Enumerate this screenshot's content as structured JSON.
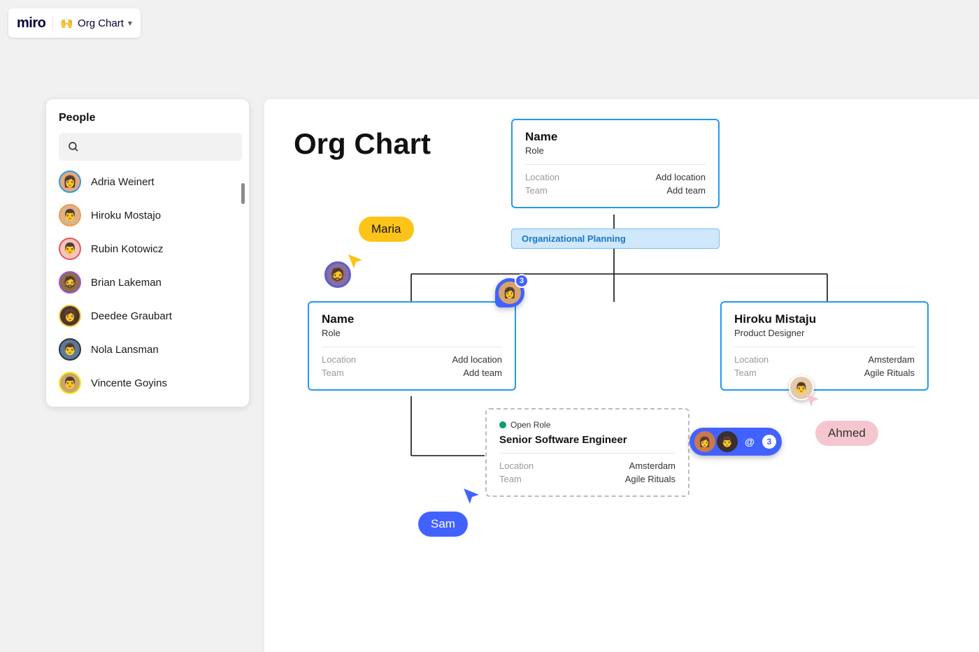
{
  "header": {
    "logo_text": "miro",
    "board_emoji": "🙌",
    "board_name": "Org Chart"
  },
  "sidebar": {
    "title": "People",
    "search_placeholder": "",
    "people": [
      {
        "name": "Adria Weinert",
        "avatar_bg": "#e8a87c",
        "avatar_border": "#2d9cdb"
      },
      {
        "name": "Hiroku Mostajo",
        "avatar_bg": "#d9b48f",
        "avatar_border": "#f2994a"
      },
      {
        "name": "Rubin Kotowicz",
        "avatar_bg": "#f2c4c4",
        "avatar_border": "#eb5757"
      },
      {
        "name": "Brian Lakeman",
        "avatar_bg": "#8b6f47",
        "avatar_border": "#9b51e0"
      },
      {
        "name": "Deedee Graubart",
        "avatar_bg": "#4a3728",
        "avatar_border": "#f2c94c"
      },
      {
        "name": "Nola Lansman",
        "avatar_bg": "#5b7a99",
        "avatar_border": "#333333"
      },
      {
        "name": "Vincente Goyins",
        "avatar_bg": "#c9a66b",
        "avatar_border": "#f8e71c"
      }
    ]
  },
  "canvas": {
    "title": "Org Chart",
    "planning_chip": "Organizational Planning",
    "cards": {
      "top": {
        "name": "Name",
        "role": "Role",
        "location_label": "Location",
        "location_value": "Add location",
        "team_label": "Team",
        "team_value": "Add team"
      },
      "left": {
        "name": "Name",
        "role": "Role",
        "location_label": "Location",
        "location_value": "Add location",
        "team_label": "Team",
        "team_value": "Add team"
      },
      "right": {
        "name": "Hiroku Mistaju",
        "role": "Product Designer",
        "location_label": "Location",
        "location_value": "Amsterdam",
        "team_label": "Team",
        "team_value": "Agile Rituals"
      },
      "open": {
        "open_label": "Open Role",
        "title": "Senior Software Engineer",
        "location_label": "Location",
        "location_value": "Amsterdam",
        "team_label": "Team",
        "team_value": "Agile Rituals"
      }
    },
    "cursors": {
      "maria": "Maria",
      "ahmed": "Ahmed",
      "sam": "Sam"
    },
    "comment_counts": {
      "single": "3",
      "group": "3"
    }
  }
}
